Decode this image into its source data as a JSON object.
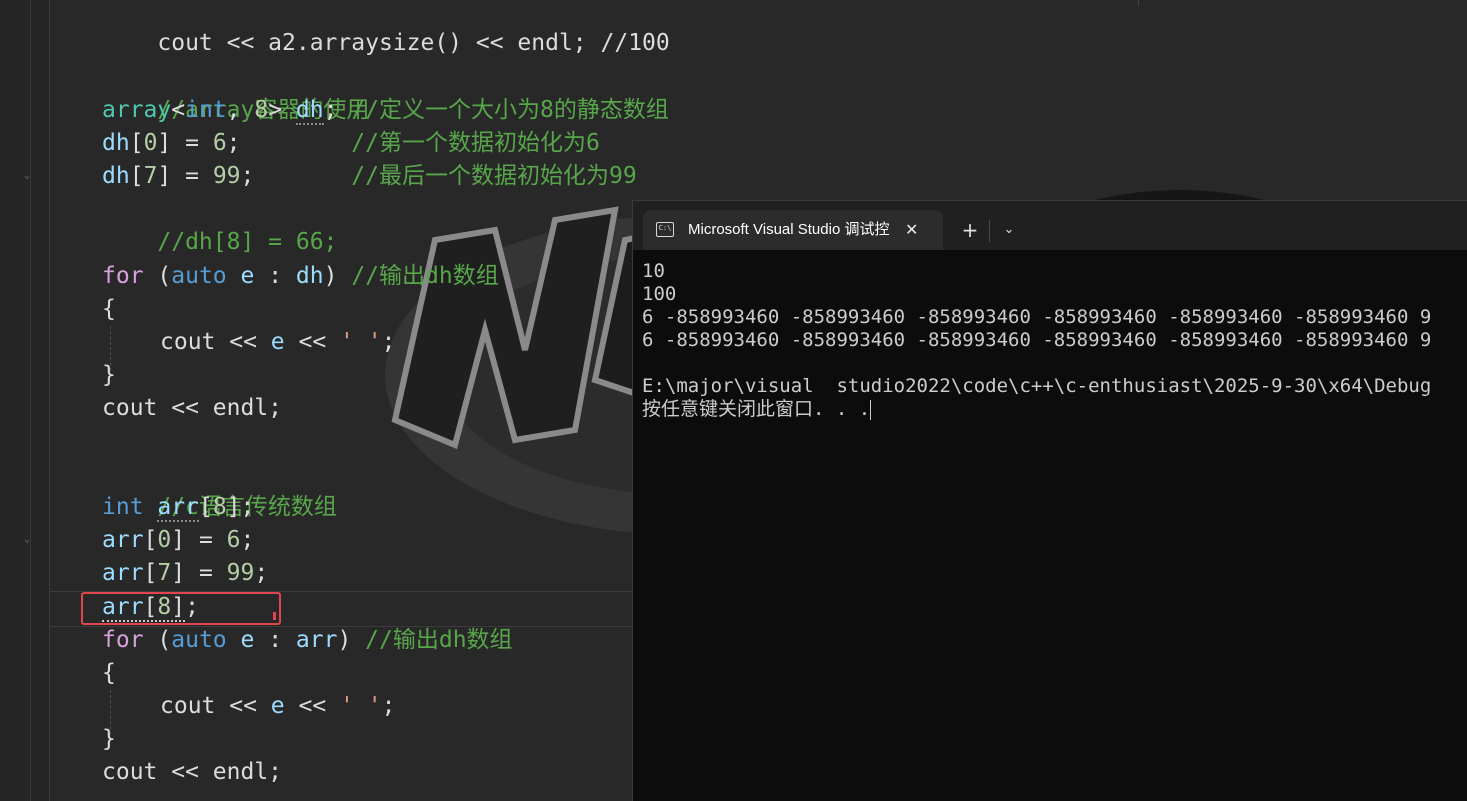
{
  "editor": {
    "top_partial": "cout << a2.arraysize() << endl; //100",
    "lines": [
      {
        "comment": "//array容器的使用"
      },
      {
        "tpl": "array",
        "type": "int",
        "size": "8",
        "var": "dh",
        "comment": "//定义一个大小为8的静态数组"
      },
      {
        "var": "dh",
        "idx": "0",
        "val": "6",
        "comment": "//第一个数据初始化为6"
      },
      {
        "var": "dh",
        "idx": "7",
        "val": "99",
        "comment": "//最后一个数据初始化为99"
      },
      {
        "comment": "//dh[8] = 66;"
      },
      {
        "kw": "for",
        "auto": "auto",
        "e": "e",
        "range": "dh",
        "comment": "//输出dh数组"
      },
      {
        "brace": "{"
      },
      {
        "cout": "cout",
        "e": "e",
        "str": "' '"
      },
      {
        "brace": "}"
      },
      {
        "cout": "cout",
        "endl": "endl"
      },
      {
        "comment": "//c语言传统数组"
      },
      {
        "type": "int",
        "var": "arr",
        "size": "8"
      },
      {
        "var": "arr",
        "idx": "0",
        "val": "6"
      },
      {
        "var": "arr",
        "idx": "7",
        "val": "99"
      },
      {
        "var": "arr",
        "idx": "8"
      },
      {
        "kw": "for",
        "auto": "auto",
        "e": "e",
        "range": "arr",
        "comment": "//输出dh数组"
      },
      {
        "brace": "{"
      },
      {
        "cout": "cout",
        "e": "e",
        "str": "' '"
      },
      {
        "brace": "}"
      },
      {
        "cout": "cout",
        "endl": "endl"
      }
    ]
  },
  "console": {
    "tab_title": "Microsoft Visual Studio 调试控",
    "tab_icon": "C:\\",
    "close_glyph": "✕",
    "new_tab_glyph": "+",
    "dropdown_glyph": "⌄",
    "output_lines": [
      "10",
      "100",
      "6 -858993460 -858993460 -858993460 -858993460 -858993460 -858993460 9",
      "6 -858993460 -858993460 -858993460 -858993460 -858993460 -858993460 9",
      "",
      "E:\\major\\visual  studio2022\\code\\c++\\c-enthusiast\\2025-9-30\\x64\\Debug",
      "按任意键关闭此窗口. . ."
    ]
  },
  "colors": {
    "editor_bg": "#282828",
    "keyword": "#569cd6",
    "control": "#d8a0df",
    "comment": "#57a64a",
    "variable": "#9cdcfe",
    "template": "#4ec9b0",
    "number": "#b5cea8",
    "string": "#d69d85",
    "highlight_box": "#e2454f",
    "console_bg": "#0c0c0c"
  }
}
